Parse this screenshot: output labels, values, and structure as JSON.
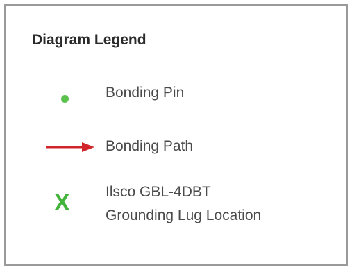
{
  "legend": {
    "title": "Diagram Legend",
    "items": [
      {
        "label": "Bonding Pin",
        "icon": "green-dot-icon",
        "color": "#5cc24f"
      },
      {
        "label": "Bonding Path",
        "icon": "red-arrow-icon",
        "color": "#d0262b"
      },
      {
        "icon": "green-x-icon",
        "symbol": "X",
        "color": "#44b33c",
        "label_line1": "Ilsco GBL-4DBT",
        "label_line2": "Grounding Lug Location"
      }
    ]
  }
}
